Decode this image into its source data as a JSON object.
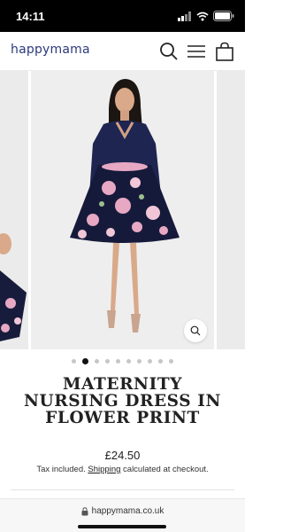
{
  "status_bar": {
    "time": "14:11"
  },
  "header": {
    "logo_text": "happymama",
    "icons": [
      "search-icon",
      "menu-icon",
      "cart-icon"
    ]
  },
  "carousel": {
    "total_slides": 10,
    "active_index": 1,
    "zoom_icon": "zoom-icon"
  },
  "product": {
    "title": "MATERNITY NURSING DRESS IN FLOWER PRINT",
    "price": "£24.50",
    "tax_prefix": "Tax included.",
    "shipping_link": "Shipping",
    "tax_suffix": "calculated at checkout."
  },
  "browser": {
    "url": "happymama.co.uk",
    "lock_icon": "lock-icon"
  },
  "colors": {
    "brand": "#2d3a7c",
    "dress_top": "#1e2550",
    "dress_skirt": "#161a3a",
    "flower_pink": "#e7a8c4"
  }
}
